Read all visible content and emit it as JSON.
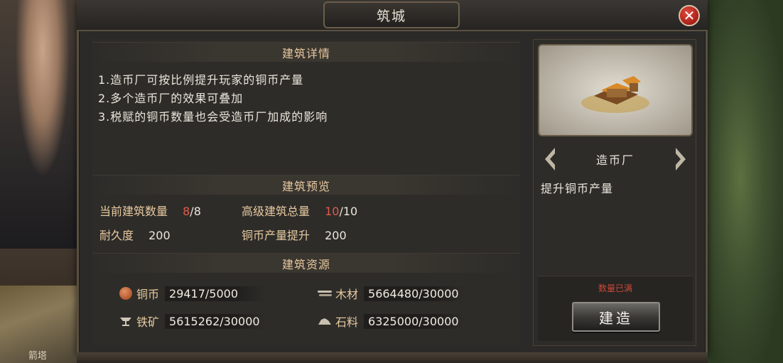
{
  "window": {
    "title": "筑城"
  },
  "left_thumb": {
    "label": "箭塔"
  },
  "details": {
    "heading": "建筑详情",
    "lines": [
      "1.造币厂可按比例提升玩家的铜币产量",
      "2.多个造币厂的效果可叠加",
      "3.税赋的铜币数量也会受造币厂加成的影响"
    ]
  },
  "preview_section": {
    "heading": "建筑预览",
    "current_count_label": "当前建筑数量",
    "current_count_value": "8",
    "current_count_max": "/8",
    "advanced_total_label": "高级建筑总量",
    "advanced_total_value": "10",
    "advanced_total_max": "/10",
    "durability_label": "耐久度",
    "durability_value": "200",
    "coin_boost_label": "铜币产量提升",
    "coin_boost_value": "200"
  },
  "resources": {
    "heading": "建筑资源",
    "items": [
      {
        "icon": "coin-icon",
        "label": "铜币",
        "value": "29417/5000"
      },
      {
        "icon": "wood-icon",
        "label": "木材",
        "value": "5664480/30000"
      },
      {
        "icon": "iron-icon",
        "label": "铁矿",
        "value": "5615262/30000"
      },
      {
        "icon": "stone-icon",
        "label": "石料",
        "value": "6325000/30000"
      }
    ]
  },
  "building": {
    "name": "造币厂",
    "description": "提升铜币产量",
    "status": "数量已满",
    "build_label": "建造"
  },
  "colors": {
    "accent_gold": "#e7c9a0",
    "warning_red": "#e25a4a",
    "close_red": "#b1251c"
  }
}
